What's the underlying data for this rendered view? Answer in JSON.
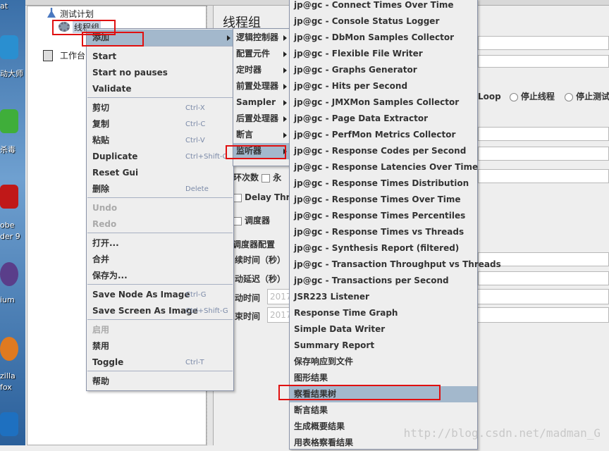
{
  "desktop": {
    "labels": [
      "at",
      "动大师",
      "杀毒",
      "obe",
      "der 9",
      "ium",
      "zilla",
      "fox"
    ]
  },
  "tree": {
    "root": "测试计划",
    "thread_group": "线程组",
    "workbench": "工作台"
  },
  "panel": {
    "title": "线程组",
    "on_error": {
      "loop": "Loop",
      "stop_thread": "停止线程",
      "stop_test": "停止测试"
    },
    "loop_count": "环次数",
    "forever": "永",
    "delay_thread": "Delay Threa",
    "scheduler": "调度器",
    "scheduler_config": "调度器配置",
    "duration": "续时间（秒）",
    "startup_delay": "动延迟（秒）",
    "start_time": "动时间",
    "start_time_value": "2017",
    "end_time": "束时间",
    "end_time_value": "2017"
  },
  "context_menu": {
    "items": [
      {
        "label": "添加",
        "highlighted": true,
        "submenu": true
      },
      {
        "label": "Start"
      },
      {
        "label": "Start no pauses"
      },
      {
        "label": "Validate"
      },
      {
        "label": "剪切",
        "shortcut": "Ctrl-X"
      },
      {
        "label": "复制",
        "shortcut": "Ctrl-C"
      },
      {
        "label": "粘贴",
        "shortcut": "Ctrl-V"
      },
      {
        "label": "Duplicate",
        "shortcut": "Ctrl+Shift-C"
      },
      {
        "label": "Reset Gui"
      },
      {
        "label": "删除",
        "shortcut": "Delete"
      },
      {
        "label": "Undo",
        "disabled": true
      },
      {
        "label": "Redo",
        "disabled": true
      },
      {
        "label": "打开..."
      },
      {
        "label": "合并"
      },
      {
        "label": "保存为..."
      },
      {
        "label": "Save Node As Image",
        "shortcut": "Ctrl-G"
      },
      {
        "label": "Save Screen As Image",
        "shortcut": "Ctrl+Shift-G"
      },
      {
        "label": "启用",
        "disabled": true
      },
      {
        "label": "禁用"
      },
      {
        "label": "Toggle",
        "shortcut": "Ctrl-T"
      },
      {
        "label": "帮助"
      }
    ]
  },
  "add_submenu": {
    "items": [
      "逻辑控制器",
      "配置元件",
      "定时器",
      "前置处理器",
      "Sampler",
      "后置处理器",
      "断言",
      "监听器"
    ],
    "highlighted": "监听器"
  },
  "listener_submenu": {
    "items": [
      "jp@gc - Connect Times Over Time",
      "jp@gc - Console Status Logger",
      "jp@gc - DbMon Samples Collector",
      "jp@gc - Flexible File Writer",
      "jp@gc - Graphs Generator",
      "jp@gc - Hits per Second",
      "jp@gc - JMXMon Samples Collector",
      "jp@gc - Page Data Extractor",
      "jp@gc - PerfMon Metrics Collector",
      "jp@gc - Response Codes per Second",
      "jp@gc - Response Latencies Over Time",
      "jp@gc - Response Times Distribution",
      "jp@gc - Response Times Over Time",
      "jp@gc - Response Times Percentiles",
      "jp@gc - Response Times vs Threads",
      "jp@gc - Synthesis Report (filtered)",
      "jp@gc - Transaction Throughput vs Threads",
      "jp@gc - Transactions per Second",
      "JSR223 Listener",
      "Response Time Graph",
      "Simple Data Writer",
      "Summary Report",
      "保存响应到文件",
      "图形结果",
      "察看结果树",
      "断言结果",
      "生成概要结果",
      "用表格察看结果"
    ],
    "highlighted": "察看结果树"
  },
  "colors": {
    "highlight": "#a3b8cc",
    "annotation": "#e01010",
    "menu_bg": "#eeeeee"
  },
  "watermark": "http://blog.csdn.net/madman_G"
}
